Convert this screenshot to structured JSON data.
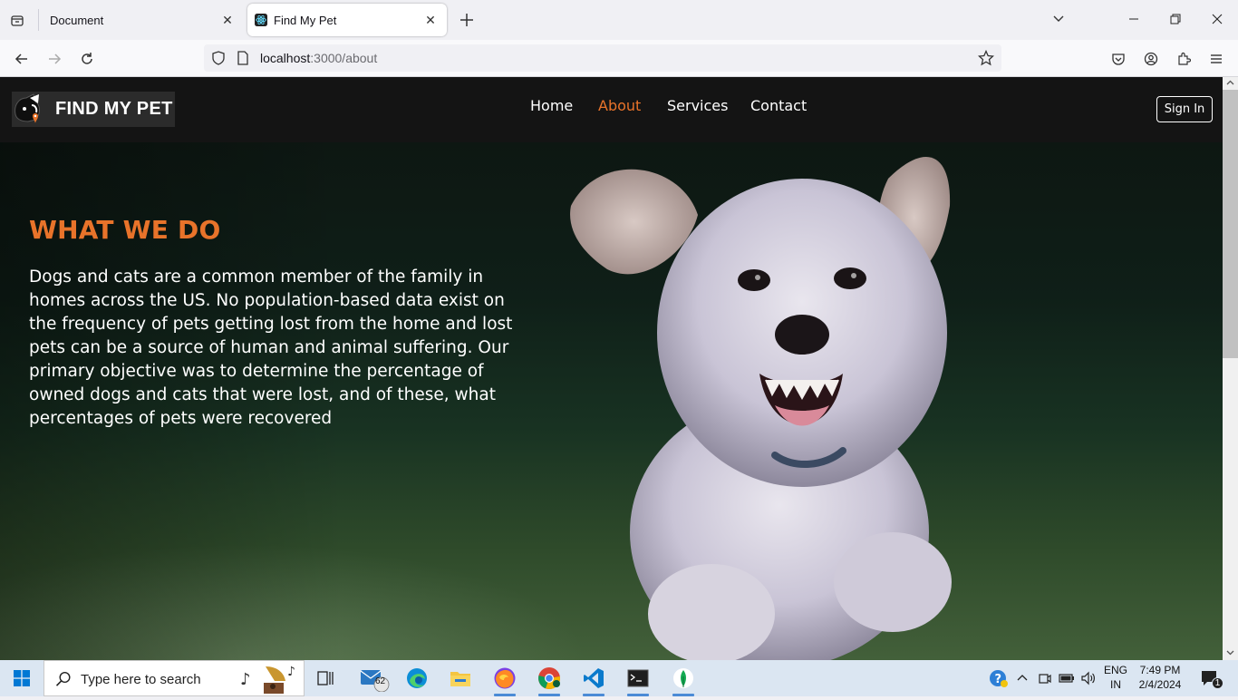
{
  "browser": {
    "tabs": [
      {
        "label": "Document",
        "active": false
      },
      {
        "label": "Find My Pet",
        "active": true
      }
    ],
    "url_host": "localhost",
    "url_path": ":3000/about"
  },
  "site": {
    "logo_text": "FIND MY PET",
    "nav": [
      {
        "label": "Home",
        "active": false
      },
      {
        "label": "About",
        "active": true
      },
      {
        "label": "Services",
        "active": false
      },
      {
        "label": "Contact",
        "active": false
      }
    ],
    "signin_label": "Sign In",
    "accent_color": "#e8732a"
  },
  "hero": {
    "title": "WHAT WE DO",
    "body": "Dogs and cats are a common member of the family in homes across the US. No population-based data exist on the frequency of pets getting lost from the home and lost pets can be a source of human and animal suffering. Our primary objective was to determine the percentage of owned dogs and cats that were lost, and of these, what percentages of pets were recovered"
  },
  "taskbar": {
    "search_placeholder": "Type here to search",
    "mail_badge": "62",
    "lang_line1": "ENG",
    "lang_line2": "IN",
    "time": "7:49 PM",
    "date": "2/4/2024",
    "notification_count": "1",
    "apps": [
      "music-widget-icon",
      "task-view-icon",
      "mail-icon",
      "edge-icon",
      "file-explorer-icon",
      "firefox-icon",
      "chrome-icon",
      "vscode-icon",
      "terminal-icon",
      "mongodb-compass-icon"
    ]
  }
}
